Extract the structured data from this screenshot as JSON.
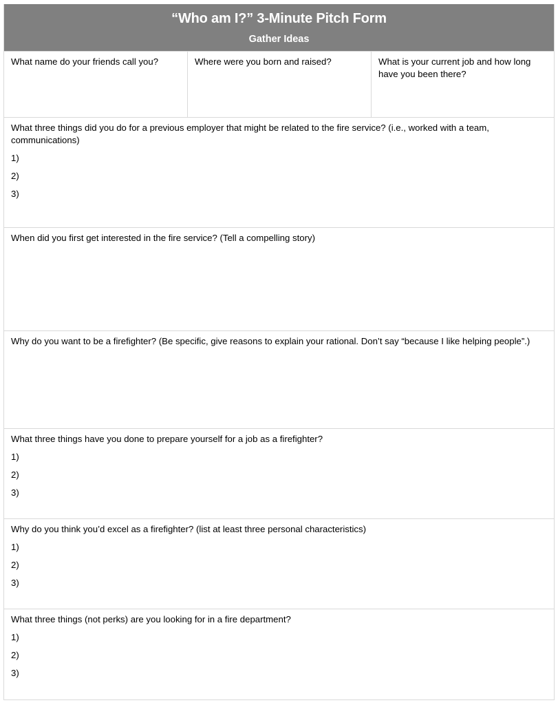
{
  "header": {
    "title": "“Who am I?” 3-Minute Pitch Form",
    "subtitle": "Gather Ideas"
  },
  "top_row": [
    "What name do your friends call you?",
    "Where were you born and raised?",
    "What is your current job and how long have you been there?"
  ],
  "questions": [
    {
      "text": "What three things did you do for a previous employer that might be related to the fire service? (i.e., worked with a team, communications)",
      "items": [
        "1)",
        "2)",
        "3)"
      ]
    },
    {
      "text": "When did you first get interested in the fire service? (Tell a compelling story)",
      "items": []
    },
    {
      "text": "Why do you want to be a firefighter? (Be specific, give reasons to explain your rational. Don’t say “because I like helping people”.)",
      "items": []
    },
    {
      "text": "What three things have you done to prepare yourself for a job as a firefighter?",
      "items": [
        "1)",
        "2)",
        "3)"
      ]
    },
    {
      "text": "Why do you think you’d excel as a firefighter? (list at least three personal characteristics)",
      "items": [
        "1)",
        "2)",
        "3)"
      ]
    },
    {
      "text": "What three things (not perks) are you looking for in a fire department?",
      "items": [
        "1)",
        "2)",
        "3)"
      ]
    }
  ],
  "colors": {
    "header_bg": "#808080",
    "header_text": "#ffffff",
    "border": "#d9d9d9"
  }
}
